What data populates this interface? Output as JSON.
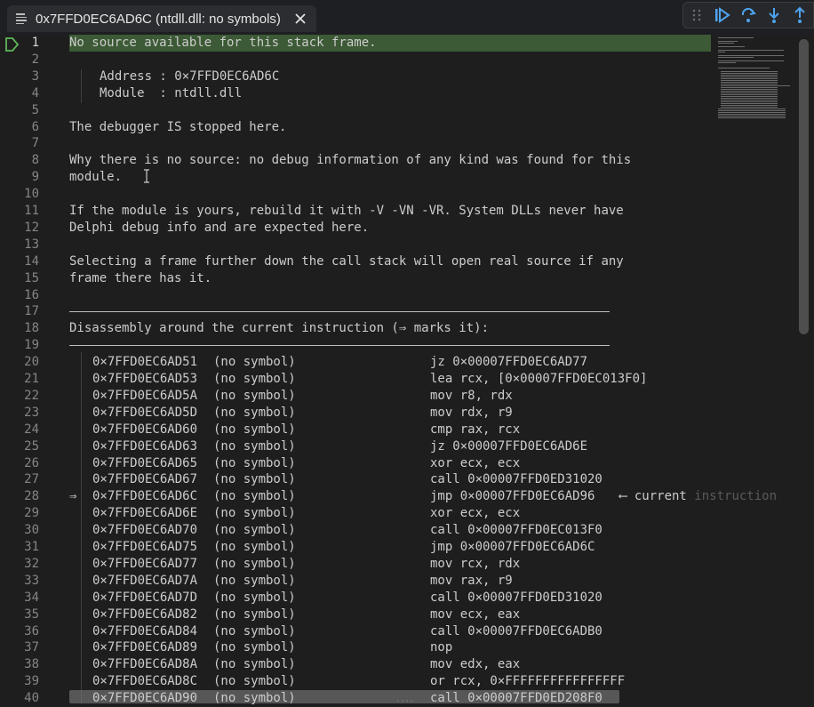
{
  "tab": {
    "title": "0x7FFD0EC6AD6C (ntdll.dll: no symbols)",
    "icon": "document-lines-icon",
    "close_icon": "close-icon"
  },
  "toolbar": {
    "buttons": [
      {
        "name": "drag-handle-icon"
      },
      {
        "name": "continue-icon"
      },
      {
        "name": "step-over-icon"
      },
      {
        "name": "step-into-icon"
      },
      {
        "name": "step-out-icon"
      }
    ],
    "accent": "#4ea3f0"
  },
  "editor": {
    "lines": [
      {
        "n": "1",
        "text": "No source available for this stack frame."
      },
      {
        "n": "2",
        "text": ""
      },
      {
        "n": "3",
        "text": "Address : 0×7FFD0EC6AD6C"
      },
      {
        "n": "4",
        "text": "Module  : ntdll.dll"
      },
      {
        "n": "5",
        "text": ""
      },
      {
        "n": "6",
        "text": "The debugger IS stopped here."
      },
      {
        "n": "7",
        "text": ""
      },
      {
        "n": "8",
        "text": "Why there is no source: no debug information of any kind was found for this"
      },
      {
        "n": "9",
        "text": "module."
      },
      {
        "n": "10",
        "text": ""
      },
      {
        "n": "11",
        "text": "If the module is yours, rebuild it with -V -VN -VR. System DLLs never have"
      },
      {
        "n": "12",
        "text": "Delphi debug info and are expected here."
      },
      {
        "n": "13",
        "text": ""
      },
      {
        "n": "14",
        "text": "Selecting a frame further down the call stack will open real source if any"
      },
      {
        "n": "15",
        "text": "frame there has it."
      },
      {
        "n": "16",
        "text": ""
      },
      {
        "n": "17",
        "text": ""
      },
      {
        "n": "18",
        "text": "Disassembly around the current instruction (⇒ marks it):"
      },
      {
        "n": "19",
        "text": ""
      }
    ],
    "disasm": [
      {
        "n": "20",
        "addr": "0×7FFD0EC6AD51",
        "sym": "(no symbol)",
        "ins": "jz 0×00007FFD0EC6AD77"
      },
      {
        "n": "21",
        "addr": "0×7FFD0EC6AD53",
        "sym": "(no symbol)",
        "ins": "lea rcx, [0×00007FFD0EC013F0]"
      },
      {
        "n": "22",
        "addr": "0×7FFD0EC6AD5A",
        "sym": "(no symbol)",
        "ins": "mov r8, rdx"
      },
      {
        "n": "23",
        "addr": "0×7FFD0EC6AD5D",
        "sym": "(no symbol)",
        "ins": "mov rdx, r9"
      },
      {
        "n": "24",
        "addr": "0×7FFD0EC6AD60",
        "sym": "(no symbol)",
        "ins": "cmp rax, rcx"
      },
      {
        "n": "25",
        "addr": "0×7FFD0EC6AD63",
        "sym": "(no symbol)",
        "ins": "jz 0×00007FFD0EC6AD6E"
      },
      {
        "n": "26",
        "addr": "0×7FFD0EC6AD65",
        "sym": "(no symbol)",
        "ins": "xor ecx, ecx"
      },
      {
        "n": "27",
        "addr": "0×7FFD0EC6AD67",
        "sym": "(no symbol)",
        "ins": "call 0×00007FFD0ED31020"
      },
      {
        "n": "28",
        "addr": "0×7FFD0EC6AD6C",
        "sym": "(no symbol)",
        "ins": "jmp 0×00007FFD0EC6AD96",
        "marker": "⇒",
        "note": "⟵ current ",
        "note_faded": "instruction"
      },
      {
        "n": "29",
        "addr": "0×7FFD0EC6AD6E",
        "sym": "(no symbol)",
        "ins": "xor ecx, ecx"
      },
      {
        "n": "30",
        "addr": "0×7FFD0EC6AD70",
        "sym": "(no symbol)",
        "ins": "call 0×00007FFD0EC013F0"
      },
      {
        "n": "31",
        "addr": "0×7FFD0EC6AD75",
        "sym": "(no symbol)",
        "ins": "jmp 0×00007FFD0EC6AD6C"
      },
      {
        "n": "32",
        "addr": "0×7FFD0EC6AD77",
        "sym": "(no symbol)",
        "ins": "mov rcx, rdx"
      },
      {
        "n": "33",
        "addr": "0×7FFD0EC6AD7A",
        "sym": "(no symbol)",
        "ins": "mov rax, r9"
      },
      {
        "n": "34",
        "addr": "0×7FFD0EC6AD7D",
        "sym": "(no symbol)",
        "ins": "call 0×00007FFD0ED31020"
      },
      {
        "n": "35",
        "addr": "0×7FFD0EC6AD82",
        "sym": "(no symbol)",
        "ins": "mov ecx, eax"
      },
      {
        "n": "36",
        "addr": "0×7FFD0EC6AD84",
        "sym": "(no symbol)",
        "ins": "call 0×00007FFD0EC6ADB0"
      },
      {
        "n": "37",
        "addr": "0×7FFD0EC6AD89",
        "sym": "(no symbol)",
        "ins": "nop"
      },
      {
        "n": "38",
        "addr": "0×7FFD0EC6AD8A",
        "sym": "(no symbol)",
        "ins": "mov edx, eax"
      },
      {
        "n": "39",
        "addr": "0×7FFD0EC6AD8C",
        "sym": "(no symbol)",
        "ins": "or rcx, 0×FFFFFFFFFFFFFFFF"
      },
      {
        "n": "40",
        "addr": "0×7FFD0EC6AD90",
        "sym": "(no symbol)",
        "ins": "call 0×00007FFD0ED208F0"
      }
    ],
    "current_line_color": "#3c5a35",
    "execution_point_icon": "execution-point-icon"
  }
}
